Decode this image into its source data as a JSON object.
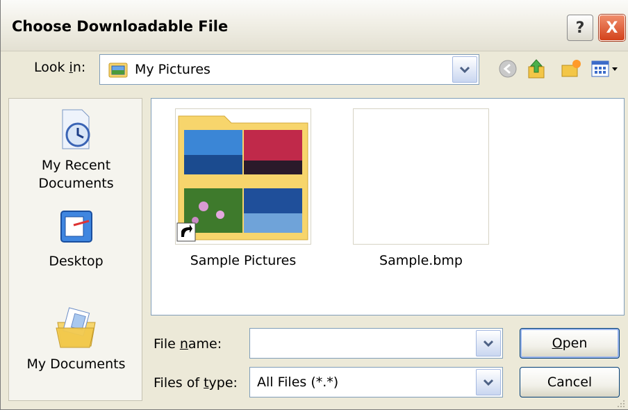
{
  "window": {
    "title": "Choose Downloadable File",
    "help_label": "?",
    "close_label": "X"
  },
  "toolbar": {
    "lookin_label_pre": "Look ",
    "lookin_label_ul": "i",
    "lookin_label_post": "n:",
    "lookin_value": "My Pictures",
    "icons": [
      "back-icon",
      "up-folder-icon",
      "new-folder-icon",
      "view-menu-icon"
    ]
  },
  "places": [
    {
      "label": "My Recent Documents",
      "icon": "recent-documents-icon"
    },
    {
      "label": "Desktop",
      "icon": "desktop-icon"
    },
    {
      "label": "My Documents",
      "icon": "my-documents-icon"
    }
  ],
  "files": [
    {
      "name": "Sample Pictures",
      "type": "folder-shortcut"
    },
    {
      "name": "Sample.bmp",
      "type": "bitmap"
    }
  ],
  "form": {
    "filename_label_pre": "File ",
    "filename_label_ul": "n",
    "filename_label_post": "ame:",
    "filename_value": "",
    "filetype_label_pre": "Files of ",
    "filetype_label_ul": "t",
    "filetype_label_post": "ype:",
    "filetype_value": "All Files (*.*)"
  },
  "buttons": {
    "open_ul": "O",
    "open_rest": "pen",
    "cancel": "Cancel"
  },
  "colors": {
    "dialog_bg": "#ece9d8",
    "close_red": "#d3431c",
    "field_border": "#7f9db9"
  }
}
